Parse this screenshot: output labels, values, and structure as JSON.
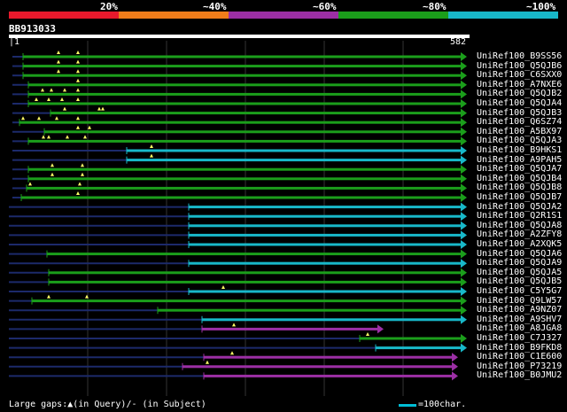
{
  "query": {
    "name": "BB913033",
    "start": "1",
    "end": "582",
    "length": 582
  },
  "legend": {
    "labels": [
      "20%",
      "~40%",
      "~60%",
      "~80%",
      "~100%"
    ],
    "colors": [
      "#e8192c",
      "#f07d1a",
      "#9c2fa5",
      "#1b9e1b",
      "#18b8c9"
    ]
  },
  "hits": [
    {
      "name": "UniRef100_B9SS56",
      "dash": [
        14,
        26
      ],
      "bar": [
        26,
        520
      ],
      "color": "green",
      "marks": [
        66,
        88
      ]
    },
    {
      "name": "UniRef100_Q5QJB6",
      "dash": [
        14,
        26
      ],
      "bar": [
        26,
        520
      ],
      "color": "green",
      "marks": [
        66,
        88
      ]
    },
    {
      "name": "UniRef100_C6SXX0",
      "dash": [
        14,
        26
      ],
      "bar": [
        26,
        520
      ],
      "color": "green",
      "marks": [
        66,
        88
      ]
    },
    {
      "name": "UniRef100_A7NXE6",
      "dash": [
        14,
        32
      ],
      "bar": [
        32,
        520
      ],
      "color": "green",
      "marks": [
        88
      ]
    },
    {
      "name": "UniRef100_Q5QJB2",
      "dash": [
        14,
        32
      ],
      "bar": [
        32,
        520
      ],
      "color": "green",
      "marks": [
        48,
        58,
        73,
        88
      ]
    },
    {
      "name": "UniRef100_Q5QJA4",
      "dash": [
        14,
        32
      ],
      "bar": [
        32,
        520
      ],
      "color": "green",
      "marks": [
        41,
        55,
        70,
        88
      ]
    },
    {
      "name": "UniRef100_Q5QJB3",
      "dash": [
        14,
        57
      ],
      "bar": [
        57,
        520
      ],
      "color": "green",
      "marks": [
        73,
        112,
        116
      ]
    },
    {
      "name": "UniRef100_Q6SZ74",
      "dash": [
        14,
        22
      ],
      "bar": [
        22,
        520
      ],
      "color": "green",
      "marks": [
        26,
        44,
        64,
        88
      ]
    },
    {
      "name": "UniRef100_A5BX97",
      "dash": [
        14,
        50
      ],
      "bar": [
        50,
        520
      ],
      "color": "green",
      "marks": [
        88,
        101
      ]
    },
    {
      "name": "UniRef100_Q5QJA3",
      "dash": [
        14,
        32
      ],
      "bar": [
        32,
        520
      ],
      "color": "green",
      "marks": [
        49,
        55,
        76,
        96
      ]
    },
    {
      "name": "UniRef100_B9HKS1",
      "dash": [
        14,
        143
      ],
      "bar": [
        143,
        520
      ],
      "color": "cyan",
      "marks": [
        171
      ]
    },
    {
      "name": "UniRef100_A9PAH5",
      "dash": [
        14,
        143
      ],
      "bar": [
        143,
        520
      ],
      "color": "cyan",
      "marks": [
        171
      ]
    },
    {
      "name": "UniRef100_Q5QJA7",
      "dash": [
        14,
        32
      ],
      "bar": [
        32,
        520
      ],
      "color": "green",
      "marks": [
        59,
        93
      ]
    },
    {
      "name": "UniRef100_Q5QJB4",
      "dash": [
        14,
        32
      ],
      "bar": [
        32,
        520
      ],
      "color": "green",
      "marks": [
        59,
        93
      ]
    },
    {
      "name": "UniRef100_Q5QJB8",
      "dash": [
        14,
        30
      ],
      "bar": [
        30,
        520
      ],
      "color": "green",
      "marks": [
        34,
        90
      ]
    },
    {
      "name": "UniRef100_Q5QJB7",
      "dash": [
        14,
        24
      ],
      "bar": [
        24,
        520
      ],
      "color": "green",
      "marks": [
        88
      ]
    },
    {
      "name": "UniRef100_Q5QJA2",
      "dash": [
        10,
        213
      ],
      "bar": [
        213,
        520
      ],
      "color": "cyan",
      "marks": []
    },
    {
      "name": "UniRef100_Q2R1S1",
      "dash": [
        10,
        213
      ],
      "bar": [
        213,
        520
      ],
      "color": "cyan",
      "marks": []
    },
    {
      "name": "UniRef100_Q5QJA8",
      "dash": [
        10,
        213
      ],
      "bar": [
        213,
        520
      ],
      "color": "cyan",
      "marks": []
    },
    {
      "name": "UniRef100_A2ZFY8",
      "dash": [
        10,
        213
      ],
      "bar": [
        213,
        520
      ],
      "color": "cyan",
      "marks": []
    },
    {
      "name": "UniRef100_A2XQK5",
      "dash": [
        10,
        213
      ],
      "bar": [
        213,
        520
      ],
      "color": "cyan",
      "marks": []
    },
    {
      "name": "UniRef100_Q5QJA6",
      "dash": [
        10,
        53
      ],
      "bar": [
        53,
        520
      ],
      "color": "green",
      "marks": []
    },
    {
      "name": "UniRef100_Q5QJA9",
      "dash": [
        10,
        213
      ],
      "bar": [
        213,
        520
      ],
      "color": "cyan",
      "marks": []
    },
    {
      "name": "UniRef100_Q5QJA5",
      "dash": [
        10,
        55
      ],
      "bar": [
        55,
        520
      ],
      "color": "green",
      "marks": []
    },
    {
      "name": "UniRef100_Q5QJB5",
      "dash": [
        10,
        55
      ],
      "bar": [
        55,
        520
      ],
      "color": "green",
      "marks": []
    },
    {
      "name": "UniRef100_C5Y5G7",
      "dash": [
        10,
        213
      ],
      "bar": [
        213,
        520
      ],
      "color": "cyan",
      "marks": [
        252
      ]
    },
    {
      "name": "UniRef100_Q9LW57",
      "dash": [
        10,
        36
      ],
      "bar": [
        36,
        520
      ],
      "color": "green",
      "marks": [
        55,
        98
      ]
    },
    {
      "name": "UniRef100_A9NZ07",
      "dash": [
        10,
        178
      ],
      "bar": [
        178,
        520
      ],
      "color": "green",
      "marks": []
    },
    {
      "name": "UniRef100_A9SHV7",
      "dash": [
        10,
        228
      ],
      "bar": [
        228,
        520
      ],
      "color": "cyan",
      "marks": []
    },
    {
      "name": "UniRef100_A8JGA8",
      "dash": [
        10,
        228
      ],
      "bar": [
        228,
        426
      ],
      "color": "purple",
      "marks": [
        264
      ]
    },
    {
      "name": "UniRef100_C7J327",
      "dash": [
        10,
        406
      ],
      "bar": [
        406,
        520
      ],
      "color": "green",
      "marks": [
        415
      ]
    },
    {
      "name": "UniRef100_B9FKD8",
      "dash": [
        10,
        424
      ],
      "bar": [
        424,
        520
      ],
      "color": "cyan",
      "marks": []
    },
    {
      "name": "UniRef100_C1E600",
      "dash": [
        10,
        230
      ],
      "bar": [
        230,
        510
      ],
      "color": "purple",
      "marks": [
        262
      ]
    },
    {
      "name": "UniRef100_P73219",
      "dash": [
        10,
        206
      ],
      "bar": [
        206,
        510
      ],
      "color": "purple",
      "marks": [
        234
      ]
    },
    {
      "name": "UniRef100_B0JMU2",
      "dash": [
        10,
        230
      ],
      "bar": [
        230,
        510
      ],
      "color": "purple",
      "marks": []
    }
  ],
  "footer": {
    "left_text": "Large gaps:▲(in Query)/- (in Subject)",
    "right_text": "=100char."
  }
}
